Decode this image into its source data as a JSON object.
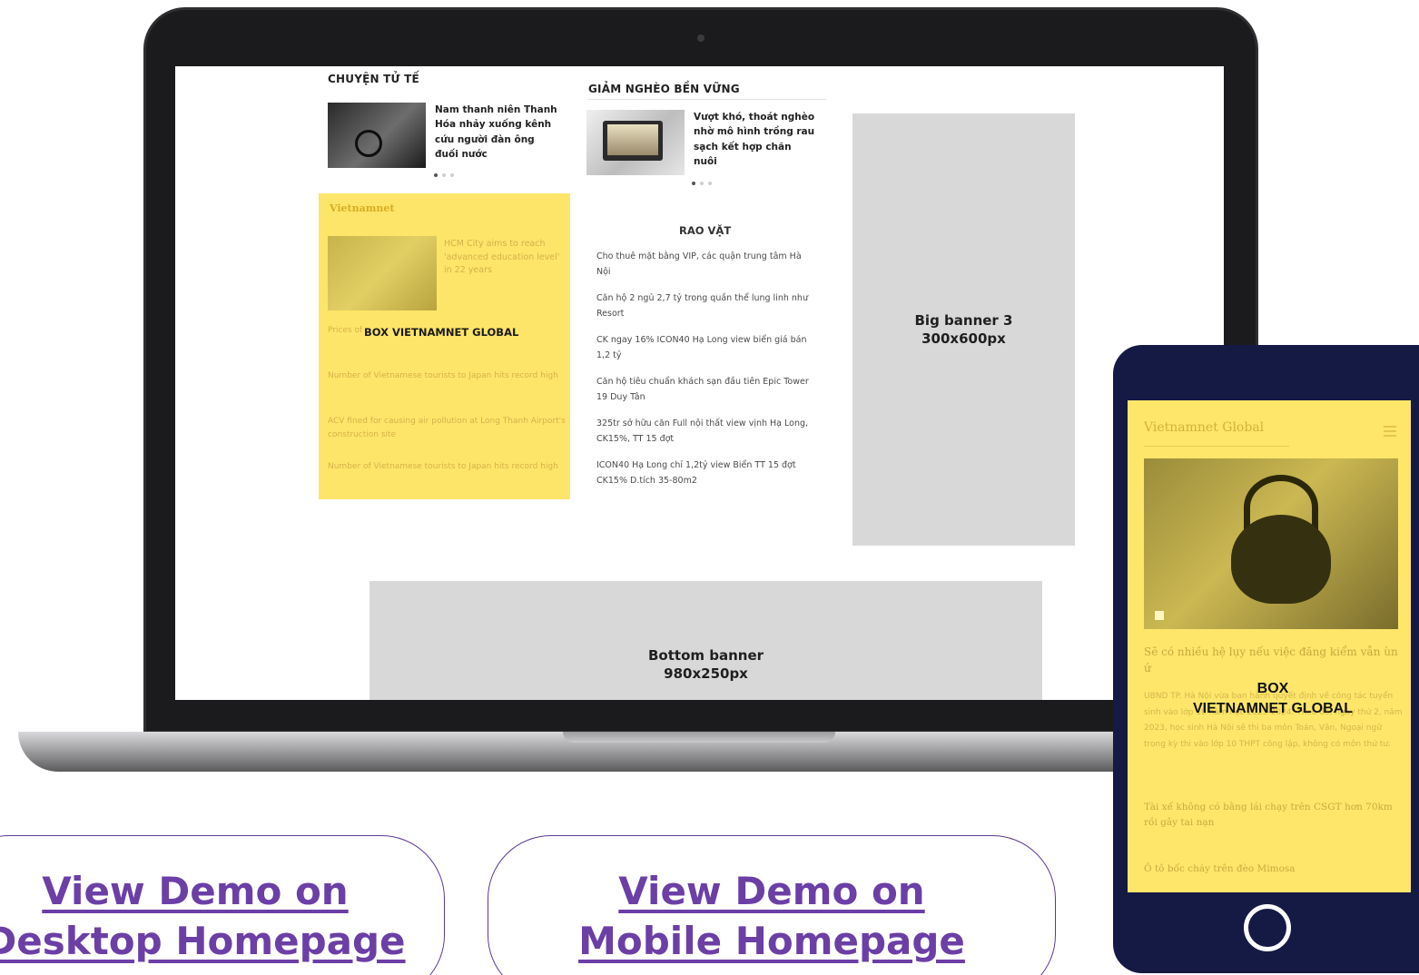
{
  "desktop": {
    "chuyen_tu_te": {
      "title": "CHUYỆN TỬ TẾ",
      "headline": "Nam thanh niên Thanh Hóa nhảy xuống kênh cứu người đàn ông đuối nước"
    },
    "giam_ngheo": {
      "title": "GIẢM NGHÈO BỀN VỮNG",
      "headline": "Vượt khó, thoát nghèo nhờ mô hình trồng rau sạch kết hợp chăn nuôi"
    },
    "yellow_box": {
      "logo": "Vietnamnet",
      "headline": "HCM City aims to reach 'advanced education level' in 22 years",
      "label": "BOX VIETNAMNET GLOBAL",
      "items": [
        "Prices of rare plants plummet in black market",
        "Number of Vietnamese tourists to Japan hits record high",
        "ACV fined for causing air pollution at Long Thanh Airport's construction site",
        "Number of Vietnamese tourists to Japan hits record high"
      ]
    },
    "rao_vat": {
      "title": "RAO VẶT",
      "items": [
        "Cho thuê mặt bằng VIP, các quận trung tâm Hà Nội",
        "Căn hộ 2 ngủ 2,7 tỷ trong quần thể lung linh như Resort",
        "CK ngay 16% ICON40 Hạ Long view biển giá bán 1,2 tỷ",
        "Căn hộ tiêu chuẩn khách sạn đầu tiên Epic Tower 19 Duy Tân",
        "325tr sở hữu căn Full nội thất view vịnh Hạ Long, CK15%, TT 15 đợt",
        "ICON40 Hạ Long chỉ 1,2tỷ view Biển TT 15 đợt CK15% D.tích 35-80m2"
      ]
    },
    "big_banner": "Big banner 3\n300x600px",
    "bottom_banner": "Bottom banner\n980x250px"
  },
  "mobile": {
    "logo": "Vietnamnet Global",
    "headline": "Sẽ có nhiều hệ lụy nếu việc đăng kiểm vẫn ùn ứ",
    "body": "UBND TP. Hà Nội vừa ban hành quyết định về công tác tuyển sinh vào lớp 10 năm học 2023-2024. Theo đó, ngày thứ 2, năm 2023, học sinh Hà Nội sẽ thi ba môn Toán, Văn, Ngoại ngữ trong kỳ thi vào lớp 10 THPT công lập, không có môn thứ tư.",
    "label": "BOX\nVIETNAMNET GLOBAL",
    "items": [
      "Tài xế không có bằng lái chạy trên CSGT hơn 70km rồi gây tai nạn",
      "Ô tô bốc cháy trên đèo Mimosa"
    ]
  },
  "cta": {
    "desktop_line1": "View Demo on",
    "desktop_line2": "Desktop Homepage",
    "mobile_line1": "View Demo on",
    "mobile_line2": "Mobile Homepage"
  },
  "colors": {
    "accent_purple": "#6b3fa6",
    "box_yellow": "#fde569",
    "phone_frame": "#151a45",
    "banner_gray": "#d8d8d8"
  }
}
